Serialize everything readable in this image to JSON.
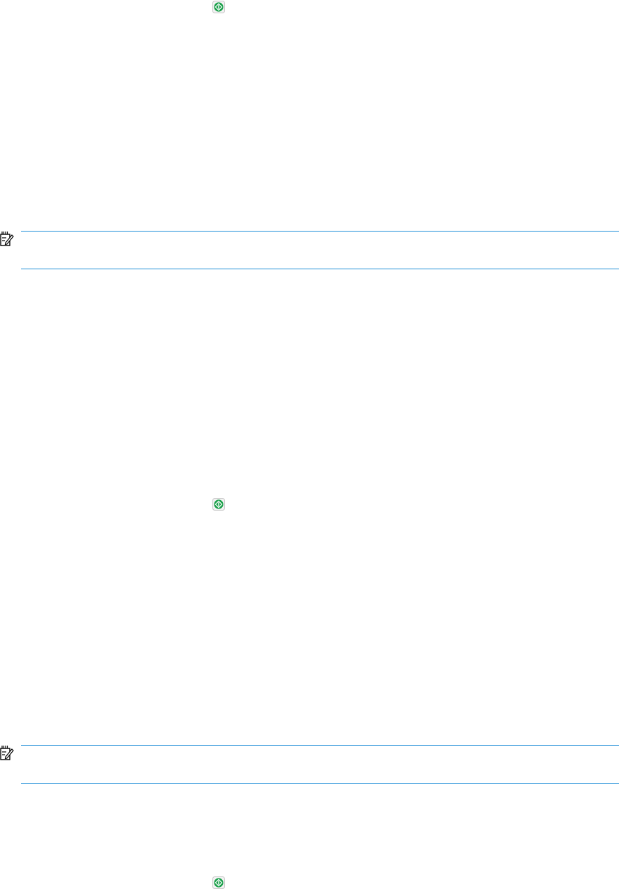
{
  "page": {
    "start_buttons": [
      {
        "icon": "start-button-icon",
        "color": "#1aa04a"
      },
      {
        "icon": "start-button-icon",
        "color": "#1aa04a"
      },
      {
        "icon": "start-button-icon",
        "color": "#1aa04a"
      }
    ],
    "notes": [
      {
        "icon": "note-pencil-icon",
        "text": ""
      },
      {
        "icon": "note-pencil-icon",
        "text": ""
      }
    ],
    "colors": {
      "rule": "#1f8ed8",
      "start_button": "#1aa04a",
      "start_button_border": "#c8c8c8"
    }
  }
}
